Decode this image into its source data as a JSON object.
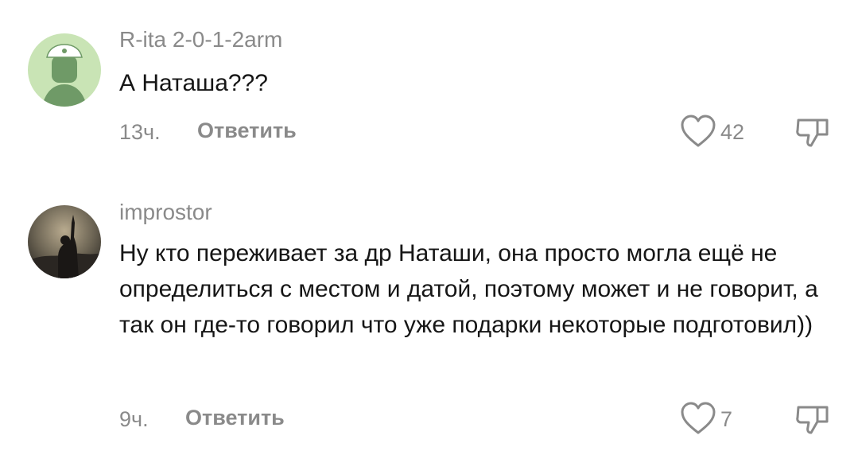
{
  "comments": [
    {
      "author": "R-ita 2-0-1-2arm",
      "text": "А Наташа???",
      "time": "13ч.",
      "reply_label": "Ответить",
      "likes": "42",
      "avatar_icon": "bucket-hat-avatar-icon"
    },
    {
      "author": "improstor",
      "text": "Ну кто переживает за др Наташи, она просто могла ещё не определиться с местом и датой, поэтому может и не говорит, а так он где-то говорил что уже подарки некоторые подготовил))",
      "time": "9ч.",
      "reply_label": "Ответить",
      "likes": "7",
      "avatar_icon": "photo-avatar"
    }
  ],
  "icons": {
    "like": "heart-icon",
    "dislike": "thumbs-down-icon"
  },
  "colors": {
    "muted_text": "#8a8a8a",
    "body_text": "#161616",
    "avatar1_bg": "#c9e4b5",
    "avatar1_figure": "#6f9a67"
  }
}
